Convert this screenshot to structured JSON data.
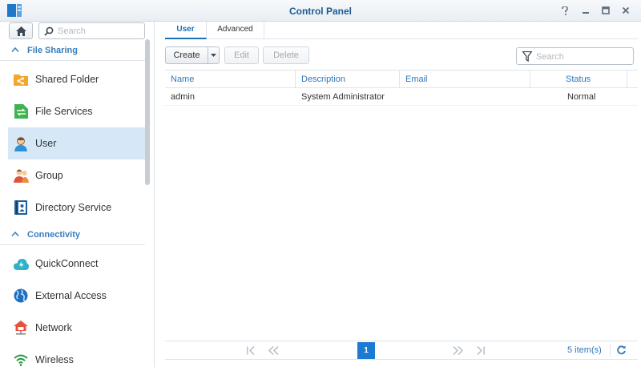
{
  "window": {
    "title": "Control Panel"
  },
  "sidebar": {
    "search_placeholder": "Search",
    "sections": [
      {
        "label": "File Sharing"
      },
      {
        "label": "Connectivity"
      }
    ],
    "items": [
      {
        "label": "Shared Folder",
        "icon": "shared-folder-icon"
      },
      {
        "label": "File Services",
        "icon": "file-services-icon"
      },
      {
        "label": "User",
        "icon": "user-icon",
        "active": true
      },
      {
        "label": "Group",
        "icon": "group-icon"
      },
      {
        "label": "Directory Service",
        "icon": "directory-service-icon"
      },
      {
        "label": "QuickConnect",
        "icon": "quickconnect-icon"
      },
      {
        "label": "External Access",
        "icon": "external-access-icon"
      },
      {
        "label": "Network",
        "icon": "network-icon"
      },
      {
        "label": "Wireless",
        "icon": "wireless-icon"
      }
    ]
  },
  "main": {
    "tabs": [
      {
        "label": "User",
        "active": true
      },
      {
        "label": "Advanced",
        "active": false
      }
    ],
    "toolbar": {
      "create_label": "Create",
      "edit_label": "Edit",
      "delete_label": "Delete",
      "filter_placeholder": "Search"
    },
    "table": {
      "columns": [
        "Name",
        "Description",
        "Email",
        "Status"
      ],
      "rows": [
        {
          "name": "admin",
          "description": "System Administrator",
          "email": "",
          "status": "Normal"
        }
      ]
    },
    "pager": {
      "current_page": "1",
      "item_count": "5 item(s)"
    }
  },
  "colors": {
    "accent": "#1d7ad3",
    "active_row": "#d6e8f8",
    "title": "#1a5b93"
  }
}
